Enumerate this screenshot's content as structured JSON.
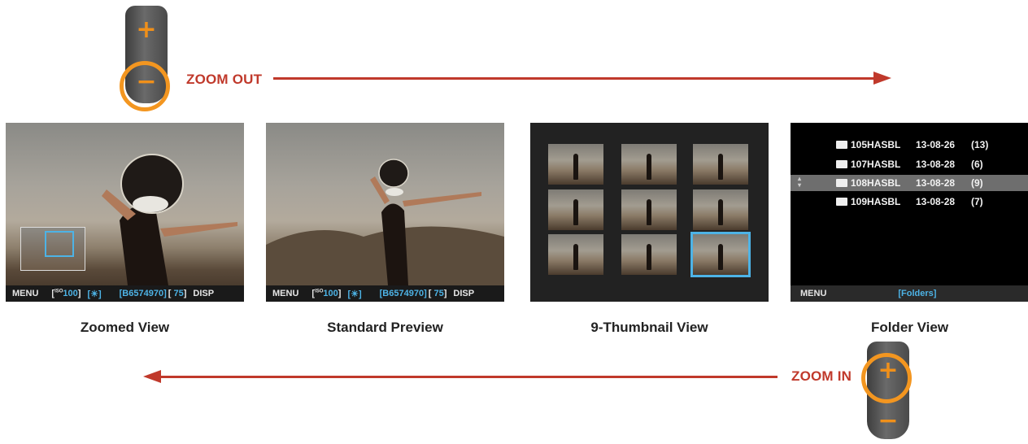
{
  "labels": {
    "zoom_out": "ZOOM OUT",
    "zoom_in": "ZOOM IN",
    "plus": "+",
    "minus": "−"
  },
  "panels": [
    {
      "caption": "Zoomed View"
    },
    {
      "caption": "Standard Preview"
    },
    {
      "caption": "9-Thumbnail View"
    },
    {
      "caption": "Folder View"
    }
  ],
  "status_bar": {
    "menu": "MENU",
    "iso_prefix": "ISO",
    "iso": "100",
    "wb_icon": "sun-icon",
    "file_id": "B6574970",
    "quality": "75",
    "disp": "DISP"
  },
  "folder_view": {
    "rows": [
      {
        "name": "105HASBL",
        "date": "13-08-26",
        "count": "(13)"
      },
      {
        "name": "107HASBL",
        "date": "13-08-28",
        "count": "(6)"
      },
      {
        "name": "108HASBL",
        "date": "13-08-28",
        "count": "(9)"
      },
      {
        "name": "109HASBL",
        "date": "13-08-28",
        "count": "(7)"
      }
    ],
    "menu": "MENU",
    "mode": "[Folders]"
  },
  "colors": {
    "arrow": "#c0392b",
    "ring": "#f39620",
    "highlight": "#4db3e6"
  }
}
